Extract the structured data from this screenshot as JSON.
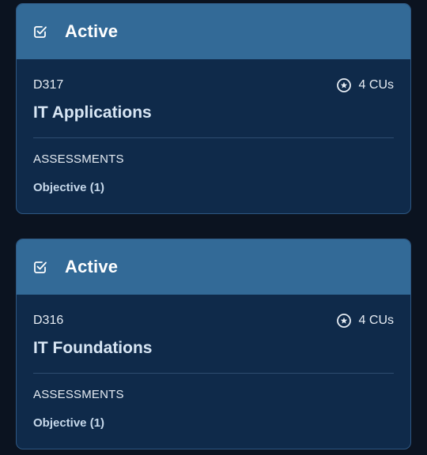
{
  "colors": {
    "page_background": "#0b1320",
    "card_background": "#0f2a4a",
    "header_background": "#336a97",
    "card_border": "#2e5782"
  },
  "cards": [
    {
      "status": "Active",
      "status_icon": "checkbox-checked-icon",
      "code": "D317",
      "cu_icon": "star-circle-icon",
      "cus": "4 CUs",
      "title": "IT Applications",
      "section_label": "ASSESSMENTS",
      "assessment": "Objective (1)"
    },
    {
      "status": "Active",
      "status_icon": "checkbox-checked-icon",
      "code": "D316",
      "cu_icon": "star-circle-icon",
      "cus": "4 CUs",
      "title": "IT Foundations",
      "section_label": "ASSESSMENTS",
      "assessment": "Objective (1)"
    }
  ]
}
